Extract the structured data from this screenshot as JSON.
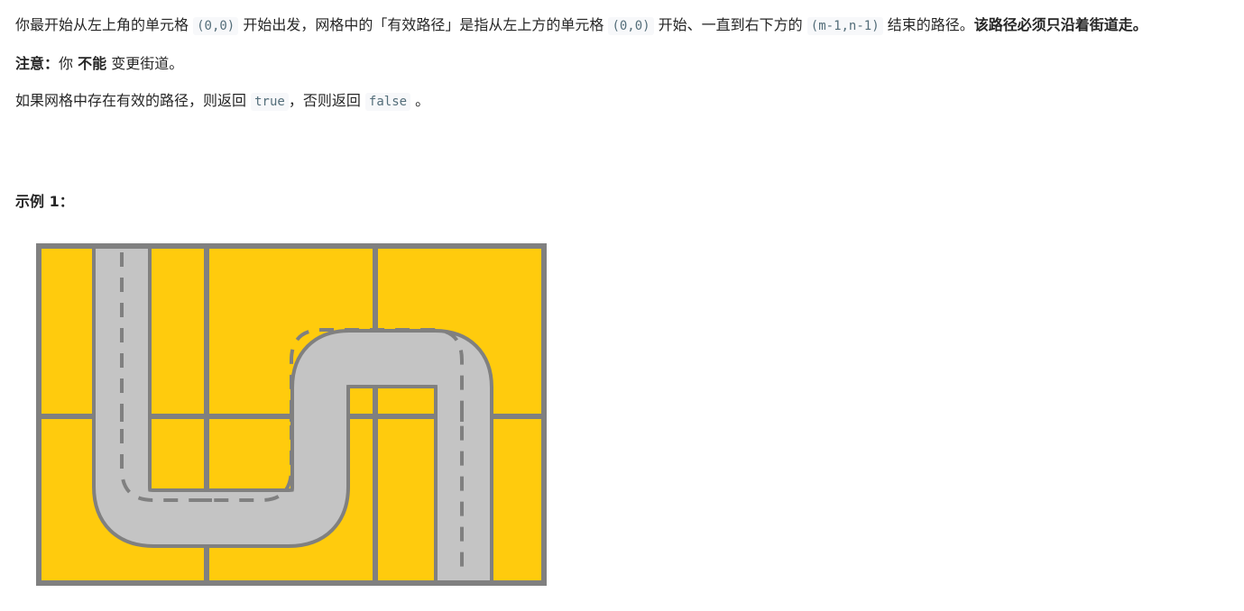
{
  "description": {
    "p1": {
      "t1": "你最开始从左上角的单元格 ",
      "c1": "(0,0)",
      "t2": " 开始出发，网格中的「有效路径」是指从左上方的单元格 ",
      "c2": "(0,0)",
      "t3": " 开始、一直到右下方的 ",
      "c3": "(m-1,n-1)",
      "t4": " 结束的路径。",
      "bold": "该路径必须只沿着街道走。"
    },
    "p2": {
      "label": "注意：",
      "t1": "你 ",
      "bold": "不能",
      "t2": " 变更街道。"
    },
    "p3": {
      "t1": "如果网格中存在有效的路径，则返回 ",
      "c1": "true",
      "t2": "，否则返回 ",
      "c2": "false",
      "t3": " 。"
    }
  },
  "example": {
    "title": "示例 1："
  },
  "colors": {
    "cell_bg": "#ffcb0d",
    "grid_line": "#808080",
    "street": "#c4c4c4",
    "street_border": "#808080",
    "dash": "#808080"
  }
}
